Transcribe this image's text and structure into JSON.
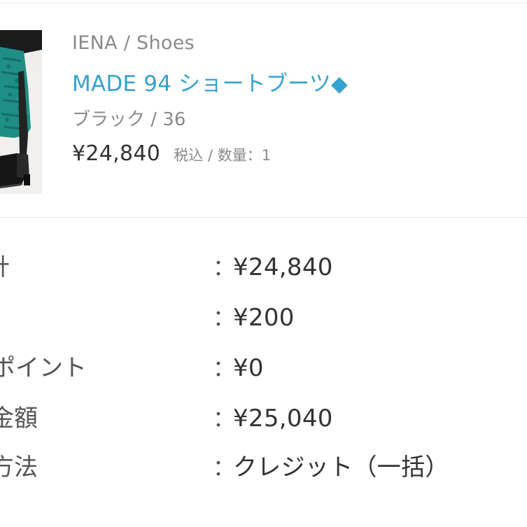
{
  "product": {
    "brand_category": "IENA / Shoes",
    "name": "MADE 94 ショートブーツ◆",
    "variant": "ブラック / 36",
    "price": "¥24,840",
    "price_note": "税込 / 数量：1",
    "thumbnail_icon": "boots-photo"
  },
  "summary": {
    "rows": [
      {
        "label": "計",
        "colon": "：",
        "value": "¥24,840"
      },
      {
        "label": "",
        "colon": "：",
        "value": "¥200"
      },
      {
        "label": "ポイント",
        "colon": "：",
        "value": "¥0"
      },
      {
        "label": "金額",
        "colon": "：",
        "value": "¥25,040"
      },
      {
        "label": "方法",
        "colon": "：",
        "value": "クレジット（一括）"
      }
    ]
  },
  "colors": {
    "link": "#36a2cf",
    "muted": "#8a8a8a",
    "text": "#333333"
  }
}
